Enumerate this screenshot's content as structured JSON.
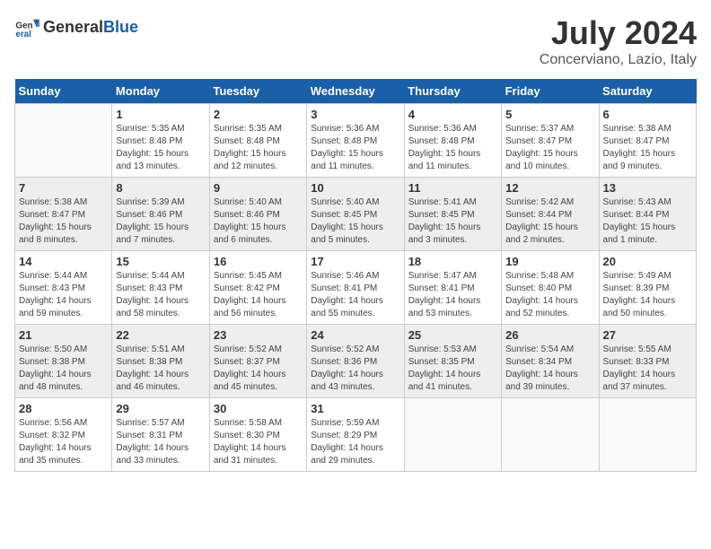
{
  "header": {
    "logo_general": "General",
    "logo_blue": "Blue",
    "month": "July 2024",
    "location": "Concerviano, Lazio, Italy"
  },
  "weekdays": [
    "Sunday",
    "Monday",
    "Tuesday",
    "Wednesday",
    "Thursday",
    "Friday",
    "Saturday"
  ],
  "weeks": [
    [
      {
        "day": "",
        "sunrise": "",
        "sunset": "",
        "daylight": ""
      },
      {
        "day": "1",
        "sunrise": "Sunrise: 5:35 AM",
        "sunset": "Sunset: 8:48 PM",
        "daylight": "Daylight: 15 hours and 13 minutes."
      },
      {
        "day": "2",
        "sunrise": "Sunrise: 5:35 AM",
        "sunset": "Sunset: 8:48 PM",
        "daylight": "Daylight: 15 hours and 12 minutes."
      },
      {
        "day": "3",
        "sunrise": "Sunrise: 5:36 AM",
        "sunset": "Sunset: 8:48 PM",
        "daylight": "Daylight: 15 hours and 11 minutes."
      },
      {
        "day": "4",
        "sunrise": "Sunrise: 5:36 AM",
        "sunset": "Sunset: 8:48 PM",
        "daylight": "Daylight: 15 hours and 11 minutes."
      },
      {
        "day": "5",
        "sunrise": "Sunrise: 5:37 AM",
        "sunset": "Sunset: 8:47 PM",
        "daylight": "Daylight: 15 hours and 10 minutes."
      },
      {
        "day": "6",
        "sunrise": "Sunrise: 5:38 AM",
        "sunset": "Sunset: 8:47 PM",
        "daylight": "Daylight: 15 hours and 9 minutes."
      }
    ],
    [
      {
        "day": "7",
        "sunrise": "Sunrise: 5:38 AM",
        "sunset": "Sunset: 8:47 PM",
        "daylight": "Daylight: 15 hours and 8 minutes."
      },
      {
        "day": "8",
        "sunrise": "Sunrise: 5:39 AM",
        "sunset": "Sunset: 8:46 PM",
        "daylight": "Daylight: 15 hours and 7 minutes."
      },
      {
        "day": "9",
        "sunrise": "Sunrise: 5:40 AM",
        "sunset": "Sunset: 8:46 PM",
        "daylight": "Daylight: 15 hours and 6 minutes."
      },
      {
        "day": "10",
        "sunrise": "Sunrise: 5:40 AM",
        "sunset": "Sunset: 8:45 PM",
        "daylight": "Daylight: 15 hours and 5 minutes."
      },
      {
        "day": "11",
        "sunrise": "Sunrise: 5:41 AM",
        "sunset": "Sunset: 8:45 PM",
        "daylight": "Daylight: 15 hours and 3 minutes."
      },
      {
        "day": "12",
        "sunrise": "Sunrise: 5:42 AM",
        "sunset": "Sunset: 8:44 PM",
        "daylight": "Daylight: 15 hours and 2 minutes."
      },
      {
        "day": "13",
        "sunrise": "Sunrise: 5:43 AM",
        "sunset": "Sunset: 8:44 PM",
        "daylight": "Daylight: 15 hours and 1 minute."
      }
    ],
    [
      {
        "day": "14",
        "sunrise": "Sunrise: 5:44 AM",
        "sunset": "Sunset: 8:43 PM",
        "daylight": "Daylight: 14 hours and 59 minutes."
      },
      {
        "day": "15",
        "sunrise": "Sunrise: 5:44 AM",
        "sunset": "Sunset: 8:43 PM",
        "daylight": "Daylight: 14 hours and 58 minutes."
      },
      {
        "day": "16",
        "sunrise": "Sunrise: 5:45 AM",
        "sunset": "Sunset: 8:42 PM",
        "daylight": "Daylight: 14 hours and 56 minutes."
      },
      {
        "day": "17",
        "sunrise": "Sunrise: 5:46 AM",
        "sunset": "Sunset: 8:41 PM",
        "daylight": "Daylight: 14 hours and 55 minutes."
      },
      {
        "day": "18",
        "sunrise": "Sunrise: 5:47 AM",
        "sunset": "Sunset: 8:41 PM",
        "daylight": "Daylight: 14 hours and 53 minutes."
      },
      {
        "day": "19",
        "sunrise": "Sunrise: 5:48 AM",
        "sunset": "Sunset: 8:40 PM",
        "daylight": "Daylight: 14 hours and 52 minutes."
      },
      {
        "day": "20",
        "sunrise": "Sunrise: 5:49 AM",
        "sunset": "Sunset: 8:39 PM",
        "daylight": "Daylight: 14 hours and 50 minutes."
      }
    ],
    [
      {
        "day": "21",
        "sunrise": "Sunrise: 5:50 AM",
        "sunset": "Sunset: 8:38 PM",
        "daylight": "Daylight: 14 hours and 48 minutes."
      },
      {
        "day": "22",
        "sunrise": "Sunrise: 5:51 AM",
        "sunset": "Sunset: 8:38 PM",
        "daylight": "Daylight: 14 hours and 46 minutes."
      },
      {
        "day": "23",
        "sunrise": "Sunrise: 5:52 AM",
        "sunset": "Sunset: 8:37 PM",
        "daylight": "Daylight: 14 hours and 45 minutes."
      },
      {
        "day": "24",
        "sunrise": "Sunrise: 5:52 AM",
        "sunset": "Sunset: 8:36 PM",
        "daylight": "Daylight: 14 hours and 43 minutes."
      },
      {
        "day": "25",
        "sunrise": "Sunrise: 5:53 AM",
        "sunset": "Sunset: 8:35 PM",
        "daylight": "Daylight: 14 hours and 41 minutes."
      },
      {
        "day": "26",
        "sunrise": "Sunrise: 5:54 AM",
        "sunset": "Sunset: 8:34 PM",
        "daylight": "Daylight: 14 hours and 39 minutes."
      },
      {
        "day": "27",
        "sunrise": "Sunrise: 5:55 AM",
        "sunset": "Sunset: 8:33 PM",
        "daylight": "Daylight: 14 hours and 37 minutes."
      }
    ],
    [
      {
        "day": "28",
        "sunrise": "Sunrise: 5:56 AM",
        "sunset": "Sunset: 8:32 PM",
        "daylight": "Daylight: 14 hours and 35 minutes."
      },
      {
        "day": "29",
        "sunrise": "Sunrise: 5:57 AM",
        "sunset": "Sunset: 8:31 PM",
        "daylight": "Daylight: 14 hours and 33 minutes."
      },
      {
        "day": "30",
        "sunrise": "Sunrise: 5:58 AM",
        "sunset": "Sunset: 8:30 PM",
        "daylight": "Daylight: 14 hours and 31 minutes."
      },
      {
        "day": "31",
        "sunrise": "Sunrise: 5:59 AM",
        "sunset": "Sunset: 8:29 PM",
        "daylight": "Daylight: 14 hours and 29 minutes."
      },
      {
        "day": "",
        "sunrise": "",
        "sunset": "",
        "daylight": ""
      },
      {
        "day": "",
        "sunrise": "",
        "sunset": "",
        "daylight": ""
      },
      {
        "day": "",
        "sunrise": "",
        "sunset": "",
        "daylight": ""
      }
    ]
  ],
  "row_backgrounds": [
    "#ffffff",
    "#eeeeee",
    "#ffffff",
    "#eeeeee",
    "#ffffff"
  ]
}
